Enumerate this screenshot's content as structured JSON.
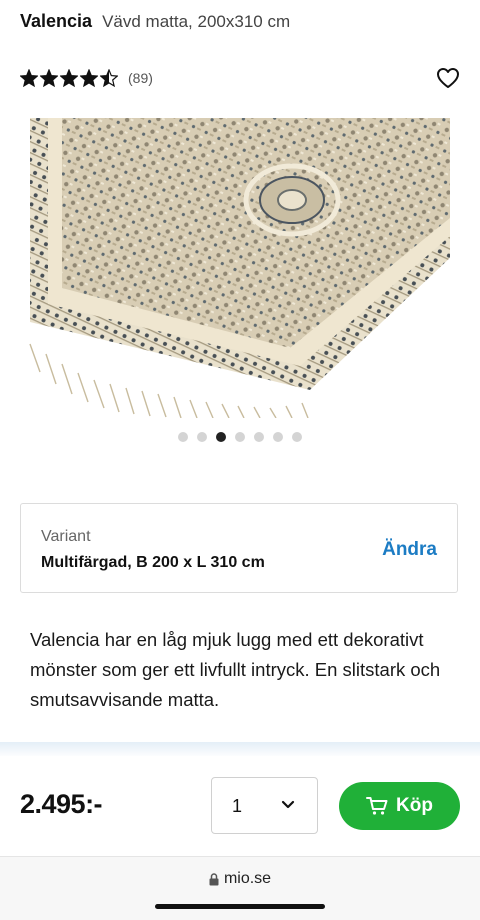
{
  "product": {
    "brand": "Valencia",
    "subtitle": "Vävd matta, 200x310 cm",
    "rating": 4.5,
    "rating_max": 5,
    "review_count": "(89)",
    "description": "Valencia har en låg mjuk lugg med ett dekorativt mönster som ger ett livfullt intryck. En slitstark och smutsavvisande matta."
  },
  "gallery": {
    "image_count": 7,
    "active_index": 2,
    "image_name": "rug-product-image"
  },
  "variant": {
    "label": "Variant",
    "value": "Multifärgad, B 200 x L 310 cm",
    "change_label": "Ändra"
  },
  "buybar": {
    "price": "2.495:-",
    "quantity": "1",
    "buy_label": "Köp",
    "buy_color": "#20b038"
  },
  "browser": {
    "url": "mio.se"
  },
  "colors": {
    "link": "#1c7cc4",
    "accent": "#20b038"
  },
  "icons": {
    "favorite": "heart-icon",
    "cart": "cart-icon",
    "lock": "lock-icon",
    "dropdown": "chevron-down-icon"
  }
}
